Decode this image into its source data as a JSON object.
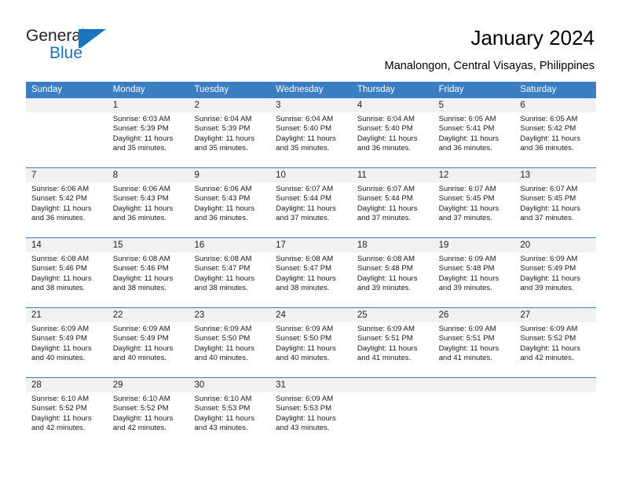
{
  "logo": {
    "text_top": "General",
    "text_bottom": "Blue",
    "accent_color": "#1b75bc",
    "icon": "triangle-logo-icon"
  },
  "header": {
    "title": "January 2024",
    "subtitle": "Manalongon, Central Visayas, Philippines"
  },
  "calendar": {
    "header_color": "#3a7dc0",
    "day_band_color": "#f1f1f1",
    "weekdays": [
      "Sunday",
      "Monday",
      "Tuesday",
      "Wednesday",
      "Thursday",
      "Friday",
      "Saturday"
    ],
    "weeks": [
      [
        {
          "date": "",
          "empty": true
        },
        {
          "date": "1",
          "sunrise": "Sunrise: 6:03 AM",
          "sunset": "Sunset: 5:39 PM",
          "daylight_1": "Daylight: 11 hours",
          "daylight_2": "and 35 minutes."
        },
        {
          "date": "2",
          "sunrise": "Sunrise: 6:04 AM",
          "sunset": "Sunset: 5:39 PM",
          "daylight_1": "Daylight: 11 hours",
          "daylight_2": "and 35 minutes."
        },
        {
          "date": "3",
          "sunrise": "Sunrise: 6:04 AM",
          "sunset": "Sunset: 5:40 PM",
          "daylight_1": "Daylight: 11 hours",
          "daylight_2": "and 35 minutes."
        },
        {
          "date": "4",
          "sunrise": "Sunrise: 6:04 AM",
          "sunset": "Sunset: 5:40 PM",
          "daylight_1": "Daylight: 11 hours",
          "daylight_2": "and 36 minutes."
        },
        {
          "date": "5",
          "sunrise": "Sunrise: 6:05 AM",
          "sunset": "Sunset: 5:41 PM",
          "daylight_1": "Daylight: 11 hours",
          "daylight_2": "and 36 minutes."
        },
        {
          "date": "6",
          "sunrise": "Sunrise: 6:05 AM",
          "sunset": "Sunset: 5:42 PM",
          "daylight_1": "Daylight: 11 hours",
          "daylight_2": "and 36 minutes."
        }
      ],
      [
        {
          "date": "7",
          "sunrise": "Sunrise: 6:06 AM",
          "sunset": "Sunset: 5:42 PM",
          "daylight_1": "Daylight: 11 hours",
          "daylight_2": "and 36 minutes."
        },
        {
          "date": "8",
          "sunrise": "Sunrise: 6:06 AM",
          "sunset": "Sunset: 5:43 PM",
          "daylight_1": "Daylight: 11 hours",
          "daylight_2": "and 36 minutes."
        },
        {
          "date": "9",
          "sunrise": "Sunrise: 6:06 AM",
          "sunset": "Sunset: 5:43 PM",
          "daylight_1": "Daylight: 11 hours",
          "daylight_2": "and 36 minutes."
        },
        {
          "date": "10",
          "sunrise": "Sunrise: 6:07 AM",
          "sunset": "Sunset: 5:44 PM",
          "daylight_1": "Daylight: 11 hours",
          "daylight_2": "and 37 minutes."
        },
        {
          "date": "11",
          "sunrise": "Sunrise: 6:07 AM",
          "sunset": "Sunset: 5:44 PM",
          "daylight_1": "Daylight: 11 hours",
          "daylight_2": "and 37 minutes."
        },
        {
          "date": "12",
          "sunrise": "Sunrise: 6:07 AM",
          "sunset": "Sunset: 5:45 PM",
          "daylight_1": "Daylight: 11 hours",
          "daylight_2": "and 37 minutes."
        },
        {
          "date": "13",
          "sunrise": "Sunrise: 6:07 AM",
          "sunset": "Sunset: 5:45 PM",
          "daylight_1": "Daylight: 11 hours",
          "daylight_2": "and 37 minutes."
        }
      ],
      [
        {
          "date": "14",
          "sunrise": "Sunrise: 6:08 AM",
          "sunset": "Sunset: 5:46 PM",
          "daylight_1": "Daylight: 11 hours",
          "daylight_2": "and 38 minutes."
        },
        {
          "date": "15",
          "sunrise": "Sunrise: 6:08 AM",
          "sunset": "Sunset: 5:46 PM",
          "daylight_1": "Daylight: 11 hours",
          "daylight_2": "and 38 minutes."
        },
        {
          "date": "16",
          "sunrise": "Sunrise: 6:08 AM",
          "sunset": "Sunset: 5:47 PM",
          "daylight_1": "Daylight: 11 hours",
          "daylight_2": "and 38 minutes."
        },
        {
          "date": "17",
          "sunrise": "Sunrise: 6:08 AM",
          "sunset": "Sunset: 5:47 PM",
          "daylight_1": "Daylight: 11 hours",
          "daylight_2": "and 38 minutes."
        },
        {
          "date": "18",
          "sunrise": "Sunrise: 6:08 AM",
          "sunset": "Sunset: 5:48 PM",
          "daylight_1": "Daylight: 11 hours",
          "daylight_2": "and 39 minutes."
        },
        {
          "date": "19",
          "sunrise": "Sunrise: 6:09 AM",
          "sunset": "Sunset: 5:48 PM",
          "daylight_1": "Daylight: 11 hours",
          "daylight_2": "and 39 minutes."
        },
        {
          "date": "20",
          "sunrise": "Sunrise: 6:09 AM",
          "sunset": "Sunset: 5:49 PM",
          "daylight_1": "Daylight: 11 hours",
          "daylight_2": "and 39 minutes."
        }
      ],
      [
        {
          "date": "21",
          "sunrise": "Sunrise: 6:09 AM",
          "sunset": "Sunset: 5:49 PM",
          "daylight_1": "Daylight: 11 hours",
          "daylight_2": "and 40 minutes."
        },
        {
          "date": "22",
          "sunrise": "Sunrise: 6:09 AM",
          "sunset": "Sunset: 5:49 PM",
          "daylight_1": "Daylight: 11 hours",
          "daylight_2": "and 40 minutes."
        },
        {
          "date": "23",
          "sunrise": "Sunrise: 6:09 AM",
          "sunset": "Sunset: 5:50 PM",
          "daylight_1": "Daylight: 11 hours",
          "daylight_2": "and 40 minutes."
        },
        {
          "date": "24",
          "sunrise": "Sunrise: 6:09 AM",
          "sunset": "Sunset: 5:50 PM",
          "daylight_1": "Daylight: 11 hours",
          "daylight_2": "and 40 minutes."
        },
        {
          "date": "25",
          "sunrise": "Sunrise: 6:09 AM",
          "sunset": "Sunset: 5:51 PM",
          "daylight_1": "Daylight: 11 hours",
          "daylight_2": "and 41 minutes."
        },
        {
          "date": "26",
          "sunrise": "Sunrise: 6:09 AM",
          "sunset": "Sunset: 5:51 PM",
          "daylight_1": "Daylight: 11 hours",
          "daylight_2": "and 41 minutes."
        },
        {
          "date": "27",
          "sunrise": "Sunrise: 6:09 AM",
          "sunset": "Sunset: 5:52 PM",
          "daylight_1": "Daylight: 11 hours",
          "daylight_2": "and 42 minutes."
        }
      ],
      [
        {
          "date": "28",
          "sunrise": "Sunrise: 6:10 AM",
          "sunset": "Sunset: 5:52 PM",
          "daylight_1": "Daylight: 11 hours",
          "daylight_2": "and 42 minutes."
        },
        {
          "date": "29",
          "sunrise": "Sunrise: 6:10 AM",
          "sunset": "Sunset: 5:52 PM",
          "daylight_1": "Daylight: 11 hours",
          "daylight_2": "and 42 minutes."
        },
        {
          "date": "30",
          "sunrise": "Sunrise: 6:10 AM",
          "sunset": "Sunset: 5:53 PM",
          "daylight_1": "Daylight: 11 hours",
          "daylight_2": "and 43 minutes."
        },
        {
          "date": "31",
          "sunrise": "Sunrise: 6:09 AM",
          "sunset": "Sunset: 5:53 PM",
          "daylight_1": "Daylight: 11 hours",
          "daylight_2": "and 43 minutes."
        },
        {
          "date": "",
          "empty": true
        },
        {
          "date": "",
          "empty": true
        },
        {
          "date": "",
          "empty": true
        }
      ]
    ]
  }
}
